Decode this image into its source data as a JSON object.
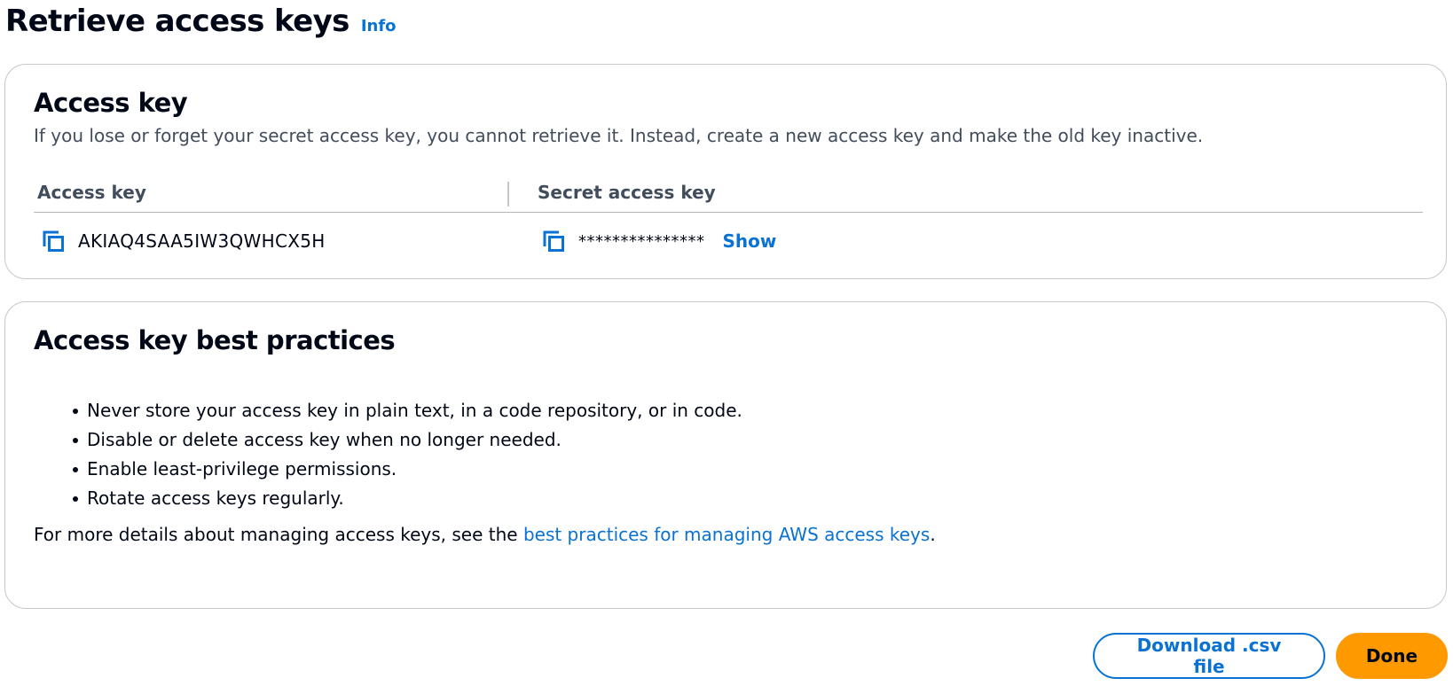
{
  "header": {
    "title": "Retrieve access keys",
    "info_label": "Info"
  },
  "access_key_card": {
    "title": "Access key",
    "description": "If you lose or forget your secret access key, you cannot retrieve it. Instead, create a new access key and make the old key inactive.",
    "columns": [
      "Access key",
      "Secret access key"
    ],
    "access_key_value": "AKIAQ4SAA5IW3QWHCX5H",
    "secret_masked": "***************",
    "show_label": "Show",
    "icons": {
      "copy": "copy-icon"
    }
  },
  "best_practices_card": {
    "title": "Access key best practices",
    "items": [
      "Never store your access key in plain text, in a code repository, or in code.",
      "Disable or delete access key when no longer needed.",
      "Enable least-privilege permissions.",
      "Rotate access keys regularly."
    ],
    "footer_prefix": "For more details about managing access keys, see the ",
    "footer_link": "best practices for managing AWS access keys",
    "footer_suffix": "."
  },
  "actions": {
    "download_label": "Download .csv file",
    "done_label": "Done"
  },
  "colors": {
    "link": "#0972d3",
    "primary_button": "#ff9900",
    "text": "#000716",
    "border": "#c6c6cd"
  }
}
